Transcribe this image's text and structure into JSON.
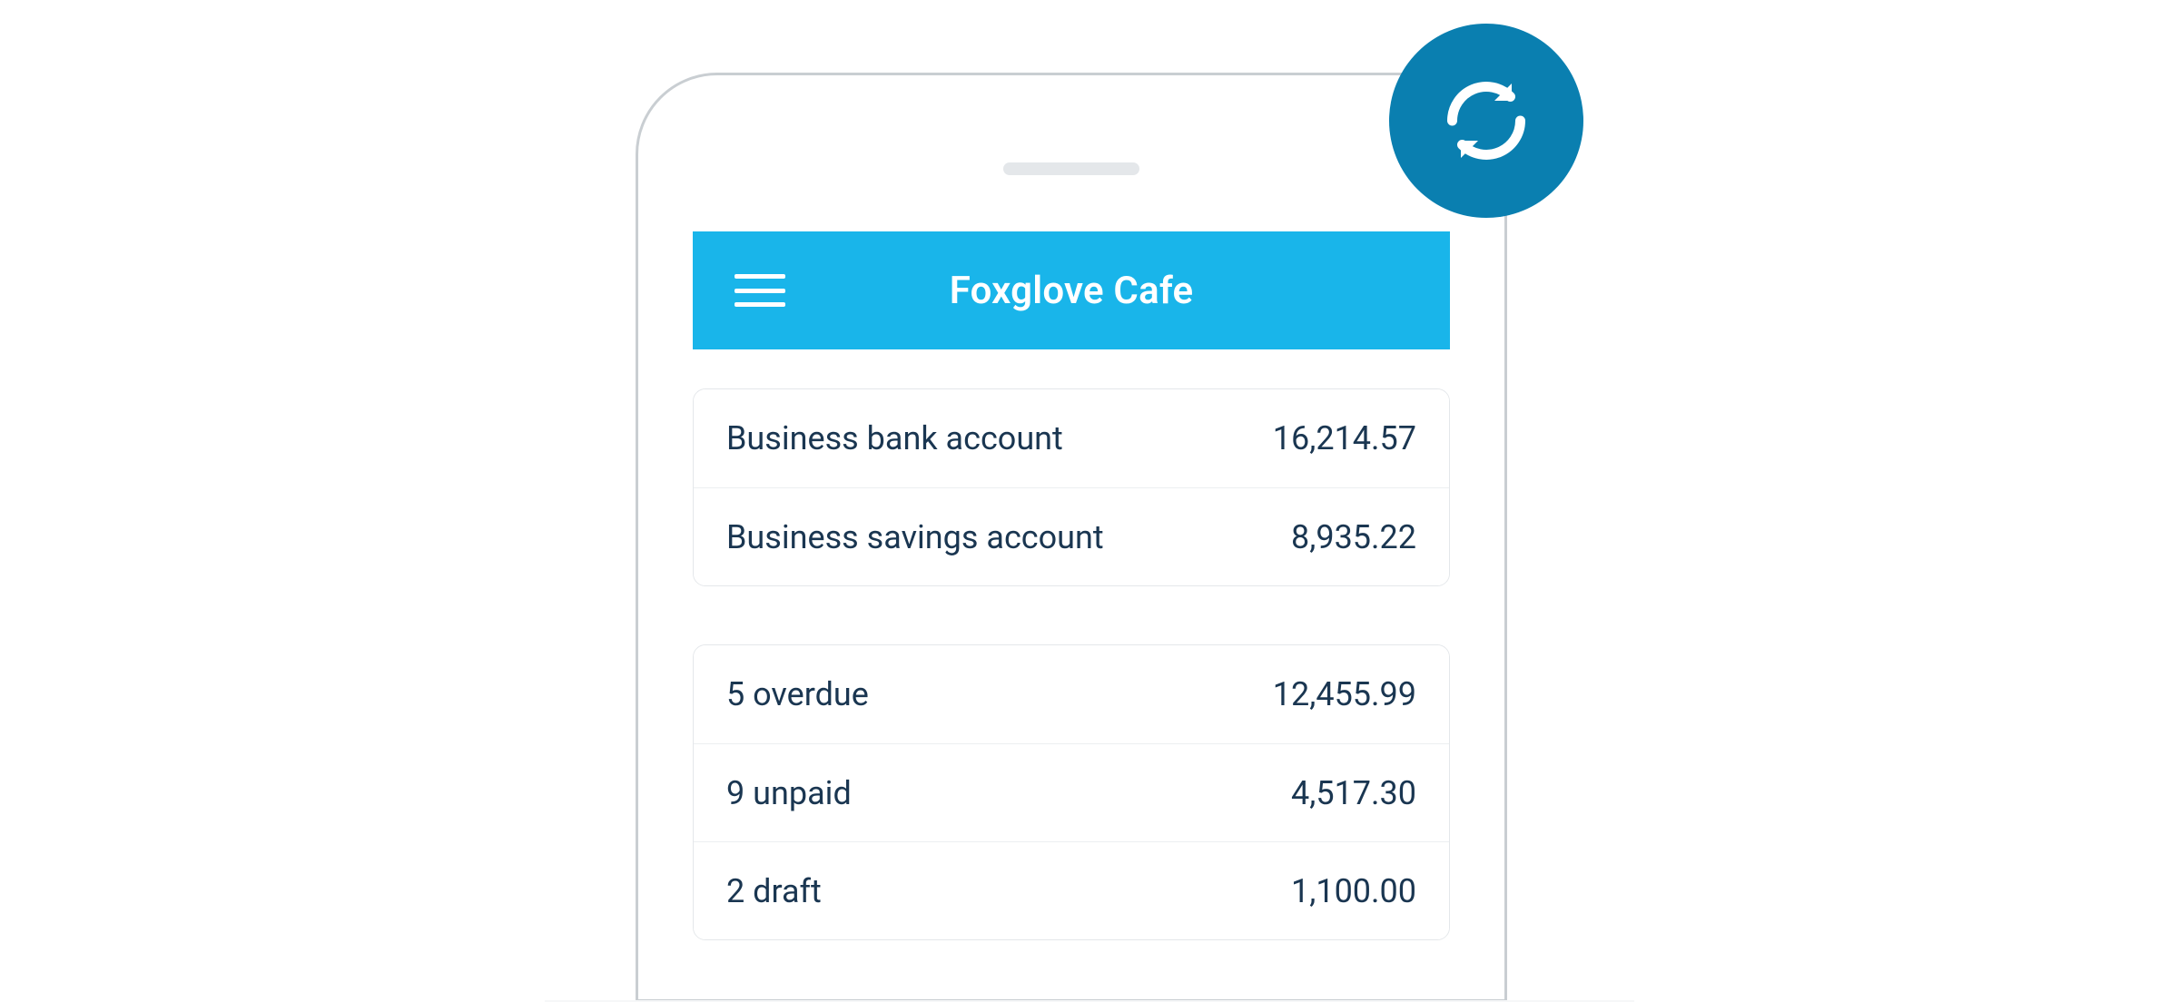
{
  "header": {
    "title": "Foxglove Cafe",
    "menu_icon": "menu-icon",
    "sync_icon": "sync-icon"
  },
  "colors": {
    "header_bg": "#19b5ea",
    "sync_bg": "#0a7fb0",
    "text": "#1a3651",
    "frame": "#c9ced2"
  },
  "accounts": [
    {
      "label": "Business bank account",
      "value": "16,214.57"
    },
    {
      "label": "Business savings account",
      "value": "8,935.22"
    }
  ],
  "invoices": [
    {
      "label": "5 overdue",
      "value": "12,455.99"
    },
    {
      "label": "9 unpaid",
      "value": "4,517.30"
    },
    {
      "label": "2 draft",
      "value": "1,100.00"
    }
  ]
}
